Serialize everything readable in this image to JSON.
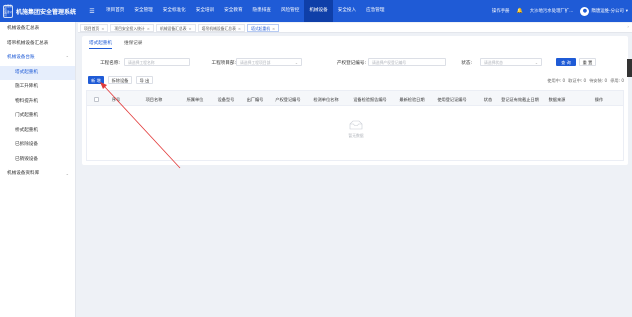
{
  "header": {
    "logo_line1": "中国路桥",
    "logo_line2": "集团公司",
    "title": "机施集团安全管理系统",
    "menu_icon": "hamburger-icon",
    "nav": [
      "项目首页",
      "安全管理",
      "安全标准化",
      "安全培训",
      "安全教育",
      "隐患排查",
      "风险管控",
      "机械设备",
      "安全投入",
      "应急管理"
    ],
    "active_nav": "机械设备",
    "manual": "操作手册",
    "notice_icon": "bell-icon",
    "org": "大沙地污水处理厂扩...",
    "user": "隋唐运维-分公司",
    "user_caret": "▾"
  },
  "sidebar": {
    "items": [
      {
        "label": "机械设备汇总表"
      },
      {
        "label": "塔吊机械设备汇总表"
      },
      {
        "label": "机械设备台账",
        "caret": "⌃"
      },
      {
        "label": "塔式起重机"
      },
      {
        "label": "施工升降机"
      },
      {
        "label": "物料提升机"
      },
      {
        "label": "门式起重机"
      },
      {
        "label": "桥式起重机"
      },
      {
        "label": "已拆除设备"
      },
      {
        "label": "已销毁设备"
      },
      {
        "label": "机械设备资料库",
        "caret": "⌄"
      }
    ]
  },
  "tabs": [
    {
      "label": "项目首页",
      "close": "×"
    },
    {
      "label": "项目安全投入统计",
      "close": "×"
    },
    {
      "label": "机械设备汇总表",
      "close": "×"
    },
    {
      "label": "塔吊机械设备汇总表",
      "close": "×"
    },
    {
      "label": "塔式起重机",
      "close": "×"
    }
  ],
  "tabs_arrow": "›",
  "subtabs": [
    "塔式起重机",
    "维保记录"
  ],
  "filters": {
    "project_label": "工程名称:",
    "project_placeholder": "请选择工程名称",
    "unit_label": "工程项目部:",
    "unit_placeholder": "请选择工程项目部",
    "reg_label": "产权登记编号:",
    "reg_placeholder": "请选择产权登记编号",
    "status_label": "状态:",
    "status_placeholder": "请选择状态",
    "dropdown_icon": "⌄",
    "search_btn": "查 询",
    "reset_btn": "重 置"
  },
  "actions": {
    "add": "新 增",
    "remove": "拆除设备",
    "export": "导 出"
  },
  "stats": {
    "text1": "使用中: 0",
    "text2": "取证中: 0",
    "text3": "待安装: 0",
    "text4": "停用: 0"
  },
  "table": {
    "columns": [
      "序号",
      "项目名称",
      "所属单位",
      "设备型号",
      "出厂编号",
      "产权登记编号",
      "检测单位名称",
      "设备检验报告编号",
      "最新检验日期",
      "使用登记证编号",
      "状态",
      "登记证有效截止日期",
      "数据来源",
      "操作"
    ],
    "empty_text": "暂无数据"
  },
  "colors": {
    "brand": "#1f5bd6",
    "annotation_arrow": "#e23a3a"
  }
}
